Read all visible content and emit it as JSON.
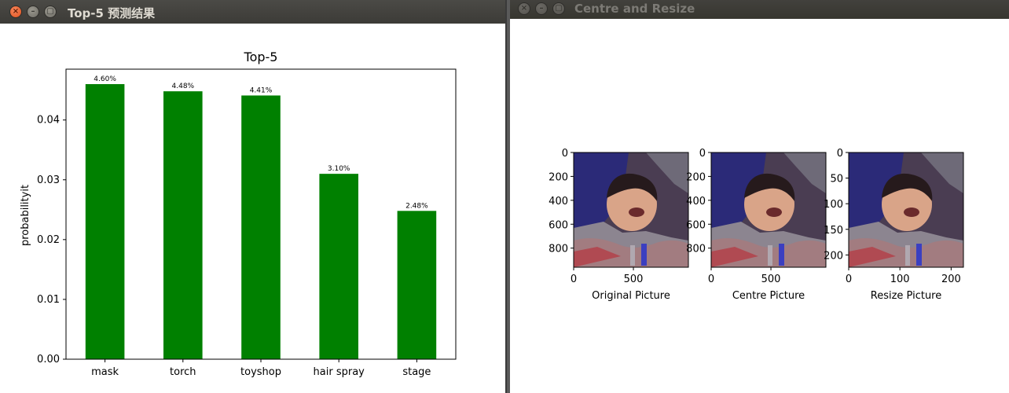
{
  "left_window": {
    "title": "Top-5 预测结果",
    "buttons": {
      "close": "×",
      "minimize": "–",
      "maximize": "▢"
    }
  },
  "right_window": {
    "title": "Centre and Resize",
    "buttons": {
      "close": "×",
      "minimize": "–",
      "maximize": "▢"
    }
  },
  "colors": {
    "bar": "#008000"
  },
  "chart_data": {
    "type": "bar",
    "title": "Top-5",
    "xlabel": "",
    "ylabel": "probabilityit",
    "categories": [
      "mask",
      "torch",
      "toyshop",
      "hair spray",
      "stage"
    ],
    "values": [
      0.046,
      0.0448,
      0.0441,
      0.031,
      0.0248
    ],
    "data_labels": [
      "4.60%",
      "4.48%",
      "4.41%",
      "3.10%",
      "2.48%"
    ],
    "ylim": [
      0,
      0.0485
    ],
    "yticks": [
      "0.00",
      "0.01",
      "0.02",
      "0.03",
      "0.04"
    ],
    "grid": false
  },
  "subplots": [
    {
      "caption": "Original Picture",
      "xticks": [
        "0",
        "500"
      ],
      "yticks": [
        "0",
        "200",
        "400",
        "600",
        "800"
      ]
    },
    {
      "caption": "Centre Picture",
      "xticks": [
        "0",
        "500"
      ],
      "yticks": [
        "0",
        "200",
        "400",
        "600",
        "800"
      ]
    },
    {
      "caption": "Resize Picture",
      "xticks": [
        "0",
        "100",
        "200"
      ],
      "yticks": [
        "0",
        "50",
        "100",
        "150",
        "200"
      ]
    }
  ]
}
